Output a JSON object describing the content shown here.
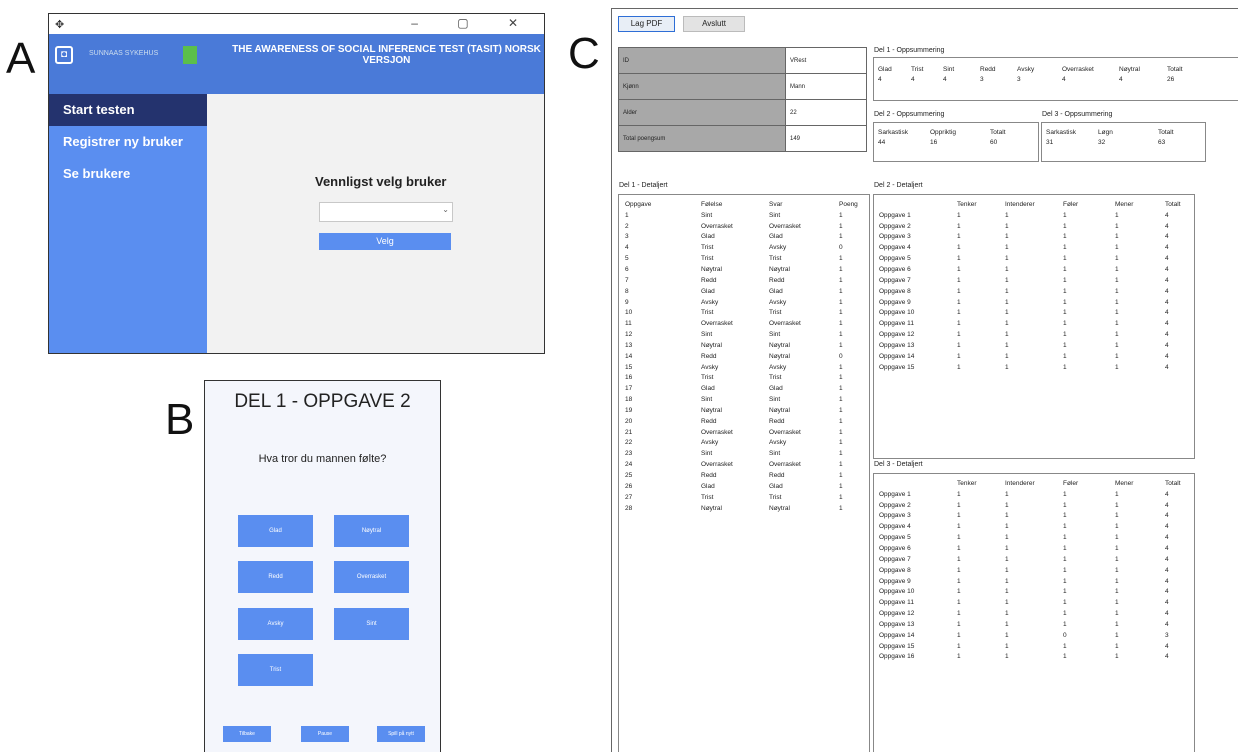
{
  "panel_letters": {
    "a": "A",
    "b": "B",
    "c": "C"
  },
  "panel_a": {
    "window_controls": "–  ▢  ✕",
    "app_title": "THE AWARENESS OF SOCIAL INFERENCE TEST (TASIT) NORSK VERSJON",
    "logo_text": "SUNNAAS SYKEHUS",
    "sidebar_items": [
      "Start testen",
      "Registrer ny bruker",
      "Se brukere"
    ],
    "prompt": "Vennligst velg bruker",
    "select_value": "",
    "choose_button": "Velg"
  },
  "panel_b": {
    "title": "DEL 1 - OPPGAVE 2",
    "question": "Hva tror du mannen følte?",
    "answers": [
      "Glad",
      "Nøytral",
      "Redd",
      "Overrasket",
      "Avsky",
      "Sint",
      "Trist"
    ],
    "nav": [
      "Tilbake",
      "Pause",
      "Spill på nytt"
    ]
  },
  "panel_c": {
    "buttons": {
      "pdf": "Lag PDF",
      "quit": "Avslutt"
    },
    "info": [
      {
        "key": "ID",
        "value": "VRest"
      },
      {
        "key": "Kjønn",
        "value": "Mann"
      },
      {
        "key": "Alder",
        "value": "22"
      },
      {
        "key": "Total poengsum",
        "value": "149"
      }
    ],
    "del1_summary": {
      "label": "Del 1 - Oppsummering",
      "headers": [
        "Glad",
        "Trist",
        "Sint",
        "Redd",
        "Avsky",
        "Overrasket",
        "Nøytral",
        "Totalt"
      ],
      "values": [
        "4",
        "4",
        "4",
        "3",
        "3",
        "4",
        "4",
        "26"
      ]
    },
    "del2_summary": {
      "label": "Del 2 - Oppsummering",
      "headers": [
        "Sarkastisk",
        "Oppriktig",
        "Totalt"
      ],
      "values": [
        "44",
        "16",
        "60"
      ]
    },
    "del3_summary": {
      "label": "Del 3 - Oppsummering",
      "headers": [
        "Sarkastisk",
        "Løgn",
        "Totalt"
      ],
      "values": [
        "31",
        "32",
        "63"
      ]
    },
    "del1_detail": {
      "label": "Del 1 - Detaljert",
      "headers": [
        "Oppgave",
        "Følelse",
        "Svar",
        "Poeng"
      ],
      "rows": [
        [
          "1",
          "Sint",
          "Sint",
          "1"
        ],
        [
          "2",
          "Overrasket",
          "Overrasket",
          "1"
        ],
        [
          "3",
          "Glad",
          "Glad",
          "1"
        ],
        [
          "4",
          "Trist",
          "Avsky",
          "0"
        ],
        [
          "5",
          "Trist",
          "Trist",
          "1"
        ],
        [
          "6",
          "Nøytral",
          "Nøytral",
          "1"
        ],
        [
          "7",
          "Redd",
          "Redd",
          "1"
        ],
        [
          "8",
          "Glad",
          "Glad",
          "1"
        ],
        [
          "9",
          "Avsky",
          "Avsky",
          "1"
        ],
        [
          "10",
          "Trist",
          "Trist",
          "1"
        ],
        [
          "11",
          "Overrasket",
          "Overrasket",
          "1"
        ],
        [
          "12",
          "Sint",
          "Sint",
          "1"
        ],
        [
          "13",
          "Nøytral",
          "Nøytral",
          "1"
        ],
        [
          "14",
          "Redd",
          "Nøytral",
          "0"
        ],
        [
          "15",
          "Avsky",
          "Avsky",
          "1"
        ],
        [
          "16",
          "Trist",
          "Trist",
          "1"
        ],
        [
          "17",
          "Glad",
          "Glad",
          "1"
        ],
        [
          "18",
          "Sint",
          "Sint",
          "1"
        ],
        [
          "19",
          "Nøytral",
          "Nøytral",
          "1"
        ],
        [
          "20",
          "Redd",
          "Redd",
          "1"
        ],
        [
          "21",
          "Overrasket",
          "Overrasket",
          "1"
        ],
        [
          "22",
          "Avsky",
          "Avsky",
          "1"
        ],
        [
          "23",
          "Sint",
          "Sint",
          "1"
        ],
        [
          "24",
          "Overrasket",
          "Overrasket",
          "1"
        ],
        [
          "25",
          "Redd",
          "Redd",
          "1"
        ],
        [
          "26",
          "Glad",
          "Glad",
          "1"
        ],
        [
          "27",
          "Trist",
          "Trist",
          "1"
        ],
        [
          "28",
          "Nøytral",
          "Nøytral",
          "1"
        ]
      ]
    },
    "del2_detail": {
      "label": "Del 2 - Detaljert",
      "headers": [
        "",
        "Tenker",
        "Intenderer",
        "Føler",
        "Mener",
        "Totalt"
      ],
      "rows": [
        [
          "Oppgave 1",
          "1",
          "1",
          "1",
          "1",
          "4"
        ],
        [
          "Oppgave 2",
          "1",
          "1",
          "1",
          "1",
          "4"
        ],
        [
          "Oppgave 3",
          "1",
          "1",
          "1",
          "1",
          "4"
        ],
        [
          "Oppgave 4",
          "1",
          "1",
          "1",
          "1",
          "4"
        ],
        [
          "Oppgave 5",
          "1",
          "1",
          "1",
          "1",
          "4"
        ],
        [
          "Oppgave 6",
          "1",
          "1",
          "1",
          "1",
          "4"
        ],
        [
          "Oppgave 7",
          "1",
          "1",
          "1",
          "1",
          "4"
        ],
        [
          "Oppgave 8",
          "1",
          "1",
          "1",
          "1",
          "4"
        ],
        [
          "Oppgave 9",
          "1",
          "1",
          "1",
          "1",
          "4"
        ],
        [
          "Oppgave 10",
          "1",
          "1",
          "1",
          "1",
          "4"
        ],
        [
          "Oppgave 11",
          "1",
          "1",
          "1",
          "1",
          "4"
        ],
        [
          "Oppgave 12",
          "1",
          "1",
          "1",
          "1",
          "4"
        ],
        [
          "Oppgave 13",
          "1",
          "1",
          "1",
          "1",
          "4"
        ],
        [
          "Oppgave 14",
          "1",
          "1",
          "1",
          "1",
          "4"
        ],
        [
          "Oppgave 15",
          "1",
          "1",
          "1",
          "1",
          "4"
        ]
      ]
    },
    "del3_detail": {
      "label": "Del 3 - Detaljert",
      "headers": [
        "",
        "Tenker",
        "Intenderer",
        "Føler",
        "Mener",
        "Totalt"
      ],
      "rows": [
        [
          "Oppgave 1",
          "1",
          "1",
          "1",
          "1",
          "4"
        ],
        [
          "Oppgave 2",
          "1",
          "1",
          "1",
          "1",
          "4"
        ],
        [
          "Oppgave 3",
          "1",
          "1",
          "1",
          "1",
          "4"
        ],
        [
          "Oppgave 4",
          "1",
          "1",
          "1",
          "1",
          "4"
        ],
        [
          "Oppgave 5",
          "1",
          "1",
          "1",
          "1",
          "4"
        ],
        [
          "Oppgave 6",
          "1",
          "1",
          "1",
          "1",
          "4"
        ],
        [
          "Oppgave 7",
          "1",
          "1",
          "1",
          "1",
          "4"
        ],
        [
          "Oppgave 8",
          "1",
          "1",
          "1",
          "1",
          "4"
        ],
        [
          "Oppgave 9",
          "1",
          "1",
          "1",
          "1",
          "4"
        ],
        [
          "Oppgave 10",
          "1",
          "1",
          "1",
          "1",
          "4"
        ],
        [
          "Oppgave 11",
          "1",
          "1",
          "1",
          "1",
          "4"
        ],
        [
          "Oppgave 12",
          "1",
          "1",
          "1",
          "1",
          "4"
        ],
        [
          "Oppgave 13",
          "1",
          "1",
          "1",
          "1",
          "4"
        ],
        [
          "Oppgave 14",
          "1",
          "1",
          "0",
          "1",
          "3"
        ],
        [
          "Oppgave 15",
          "1",
          "1",
          "1",
          "1",
          "4"
        ],
        [
          "Oppgave 16",
          "1",
          "1",
          "1",
          "1",
          "4"
        ]
      ]
    }
  }
}
